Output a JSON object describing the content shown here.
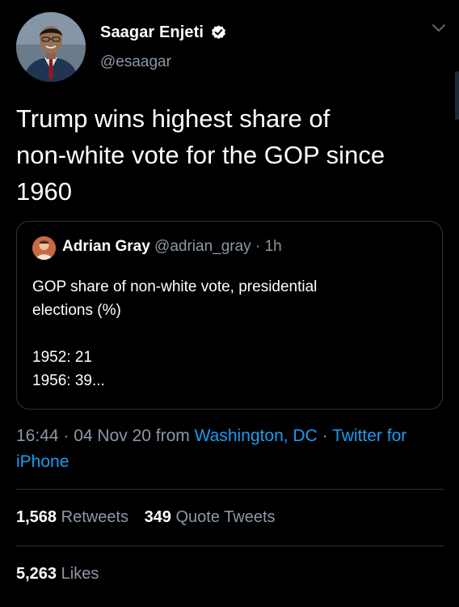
{
  "tweet": {
    "author": {
      "name": "Saagar Enjeti",
      "handle": "@esaagar",
      "verified": true
    },
    "text": "Trump wins highest share of\nnon-white vote for the GOP since\n1960",
    "quoted": {
      "name": "Adrian Gray",
      "handle": "@adrian_gray",
      "separator": "·",
      "time": "1h",
      "text": "GOP share of non-white vote, presidential\nelections (%)\n\n1952: 21\n1956: 39..."
    },
    "meta": {
      "time": "16:44",
      "sep1": " · ",
      "date": "04 Nov 20",
      "from": " from ",
      "location": "Washington, DC",
      "sep2": " · ",
      "client": "Twitter for iPhone"
    },
    "stats": {
      "retweets_count": "1,568",
      "retweets_label": "Retweets",
      "quotes_count": "349",
      "quotes_label": "Quote Tweets",
      "likes_count": "5,263",
      "likes_label": "Likes"
    }
  },
  "colors": {
    "background": "#000000",
    "primary_text": "#ffffff",
    "secondary_text": "#8b98a5",
    "link": "#1d9bf0",
    "border": "#2f3336"
  },
  "icons": {
    "verified": "verified-badge-icon",
    "more": "chevron-down-icon"
  }
}
